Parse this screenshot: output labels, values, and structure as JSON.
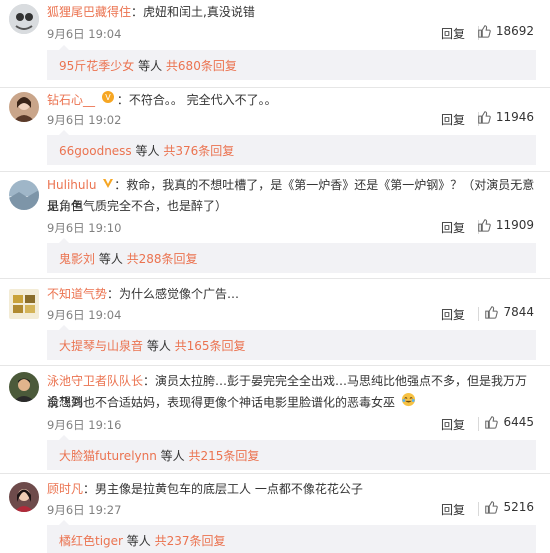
{
  "comments": [
    {
      "username": "狐狸尾巴藏得住",
      "text": "：虎妞和闰土,真没说错",
      "time": "9月6日 19:04",
      "reply_label": "回复",
      "likes": "18692",
      "sub": {
        "user": "95斤花季少女",
        "mid": " 等人 ",
        "link": "共680条回复"
      }
    },
    {
      "username": "钻石心__",
      "text": "：不符合。。 完全代入不了。。",
      "time": "9月6日 19:02",
      "reply_label": "回复",
      "likes": "11946",
      "sub": {
        "user": "66goodness",
        "mid": " 等人 ",
        "link": "共376条回复"
      }
    },
    {
      "username": "Hulihulu",
      "text_line1": "：救命，我真的不想吐槽了，是《第一炉香》还是《第一炉钢》？（对演员无意见，但",
      "text_line2": "是角色气质完全不合，也是醉了）",
      "time": "9月6日 19:10",
      "reply_label": "回复",
      "likes": "11909",
      "sub": {
        "user": "鬼影刘",
        "mid": " 等人 ",
        "link": "共288条回复"
      }
    },
    {
      "username": "不知道气势",
      "text": "：为什么感觉像个广告…",
      "time": "9月6日 19:04",
      "reply_label": "回复",
      "likes": "7844",
      "sub": {
        "user": "大提琴与山泉音",
        "mid": " 等人 ",
        "link": "共165条回复"
      }
    },
    {
      "username": "泳池守卫者队队长",
      "text_line1": "：演员太拉胯…彭于晏完完全全出戏…马思纯比他强点不多，但是我万万没想到",
      "text_line2": "俞飞鸿也不合适姑妈，表现得更像个神话电影里脸谱化的恶毒女巫",
      "time": "9月6日 19:16",
      "reply_label": "回复",
      "likes": "6445",
      "sub": {
        "user": "大脸猫futurelynn",
        "mid": " 等人 ",
        "link": "共215条回复"
      }
    },
    {
      "username": "顾时凡",
      "text": "：男主像是拉黄包车的底层工人 一点都不像花花公子",
      "time": "9月6日 19:27",
      "reply_label": "回复",
      "likes": "5216",
      "sub": {
        "user": "橘红色tiger",
        "mid": " 等人 ",
        "link": "共237条回复"
      }
    }
  ],
  "colors": {
    "accent": "#eb7350",
    "gold": "#f6a623",
    "bg_sub": "#f2f2f5"
  }
}
